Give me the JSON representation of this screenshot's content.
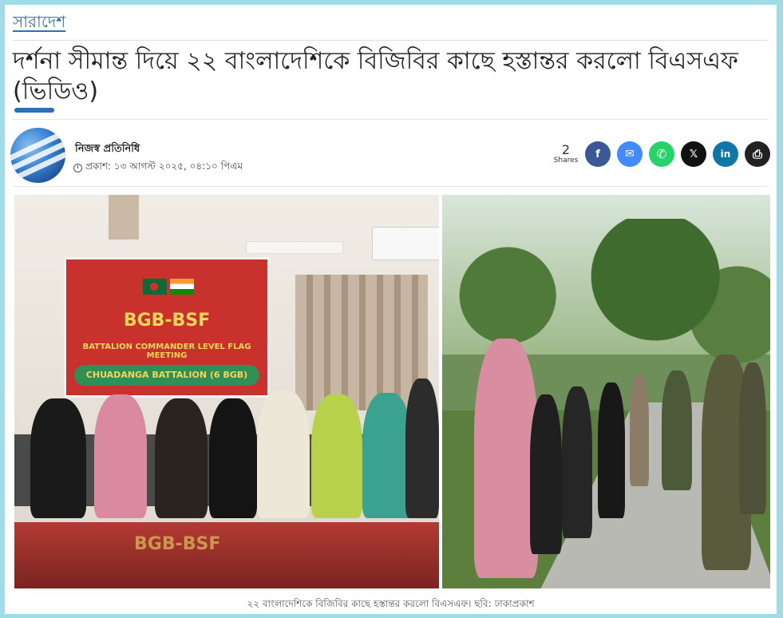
{
  "category": "সারাদেশ",
  "headline": "দর্শনা সীমান্ত দিয়ে ২২ বাংলাদেশিকে বিজিবির কাছে হস্তান্তর করলো বিএসএফ (ভিডিও)",
  "author": {
    "name": "নিজস্ব প্রতিনিধি",
    "published": "প্রকাশ: ১৩ আগস্ট ২০২৫, ০৪:১০ পিএম"
  },
  "share": {
    "count": "2",
    "count_label": "Shares",
    "buttons": [
      {
        "name": "facebook",
        "glyph": "f",
        "color": "#3b5998"
      },
      {
        "name": "messenger",
        "glyph": "✉",
        "color": "#448aff"
      },
      {
        "name": "whatsapp",
        "glyph": "✆",
        "color": "#25d366"
      },
      {
        "name": "x",
        "glyph": "𝕏",
        "color": "#111111"
      },
      {
        "name": "linkedin",
        "glyph": "in",
        "color": "#0e76a8"
      },
      {
        "name": "print",
        "glyph": "⎙",
        "color": "#222222"
      }
    ]
  },
  "photo_left": {
    "banner_title": "BGB-BSF",
    "banner_subtitle": "BATTALION COMMANDER LEVEL FLAG MEETING",
    "banner_pill": "CHUADANGA BATTALION (6 BGB)",
    "reflection": "BGB-BSF"
  },
  "caption": "২২ বাংলাদেশিকে বিজিবির কাছে হস্তান্তর করলো বিএসএফ। ছবি: ঢাকাপ্রকাশ"
}
